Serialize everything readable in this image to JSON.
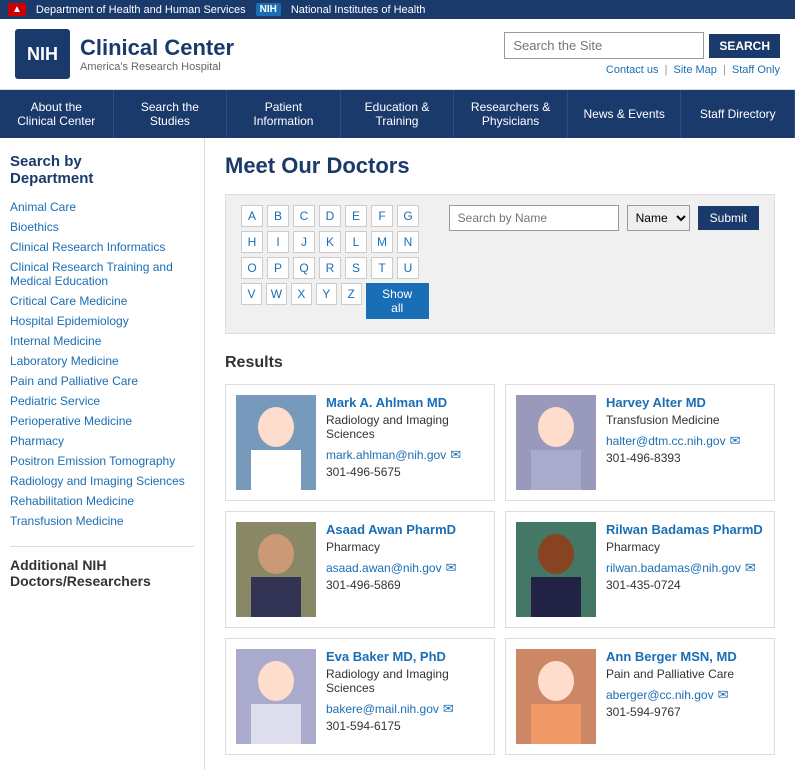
{
  "topBanner": {
    "hhs": "Department of Health and Human Services",
    "nih_badge": "NIH",
    "nih": "National Institutes of Health"
  },
  "header": {
    "logo_text": "NIH",
    "title": "Clinical Center",
    "subtitle": "America's Research Hospital",
    "search_placeholder": "Search the Site",
    "search_button": "SEARCH",
    "links": {
      "contact": "Contact us",
      "site_map": "Site Map",
      "staff_only": "Staff Only"
    }
  },
  "nav": {
    "items": [
      {
        "label": "About the\nClinical Center"
      },
      {
        "label": "Search the\nStudies"
      },
      {
        "label": "Patient\nInformation"
      },
      {
        "label": "Education &\nTraining"
      },
      {
        "label": "Researchers &\nPhysicians"
      },
      {
        "label": "News & Events"
      },
      {
        "label": "Staff Directory"
      }
    ]
  },
  "sidebar": {
    "title": "Search by\nDepartment",
    "links": [
      "Animal Care",
      "Bioethics",
      "Clinical Research Informatics",
      "Clinical Research Training and Medical Education",
      "Critical Care Medicine",
      "Hospital Epidemiology",
      "Internal Medicine",
      "Laboratory Medicine",
      "Pain and Palliative Care",
      "Pediatric Service",
      "Perioperative Medicine",
      "Pharmacy",
      "Positron Emission Tomography",
      "Radiology and Imaging Sciences",
      "Rehabilitation Medicine",
      "Transfusion Medicine"
    ],
    "additional_title": "Additional NIH\nDoctors/Researchers"
  },
  "search": {
    "alphabet": [
      [
        "A",
        "B",
        "C",
        "D",
        "E",
        "F",
        "G"
      ],
      [
        "H",
        "I",
        "J",
        "K",
        "L",
        "M",
        "N"
      ],
      [
        "O",
        "P",
        "Q",
        "R",
        "S",
        "T",
        "U"
      ],
      [
        "V",
        "W",
        "X",
        "Y",
        "Z"
      ]
    ],
    "show_all": "Show all",
    "name_placeholder": "Search by Name",
    "dropdown_options": [
      "Name"
    ],
    "submit": "Submit"
  },
  "page_title": "Meet Our Doctors",
  "results_title": "Results",
  "doctors": [
    {
      "name": "Mark A. Ahlman MD",
      "department": "Radiology and Imaging\nSciences",
      "email": "mark.ahlman@nih.gov",
      "phone": "301-496-5675",
      "photo_class": "photo-mark"
    },
    {
      "name": "Harvey Alter MD",
      "department": "Transfusion Medicine",
      "email": "halter@dtm.cc.nih.gov",
      "phone": "301-496-8393",
      "photo_class": "photo-harvey"
    },
    {
      "name": "Asaad Awan PharmD",
      "department": "Pharmacy",
      "email": "asaad.awan@nih.gov",
      "phone": "301-496-5869",
      "photo_class": "photo-asaad"
    },
    {
      "name": "Rilwan Badamas PharmD",
      "department": "Pharmacy",
      "email": "rilwan.badamas@nih.gov",
      "phone": "301-435-0724",
      "photo_class": "photo-rilwan"
    },
    {
      "name": "Eva Baker MD, PhD",
      "department": "Radiology and Imaging\nSciences",
      "email": "bakere@mail.nih.gov",
      "phone": "301-594-6175",
      "photo_class": "photo-eva"
    },
    {
      "name": "Ann Berger MSN, MD",
      "department": "Pain and Palliative Care",
      "email": "aberger@cc.nih.gov",
      "phone": "301-594-9767",
      "photo_class": "photo-ann"
    }
  ]
}
